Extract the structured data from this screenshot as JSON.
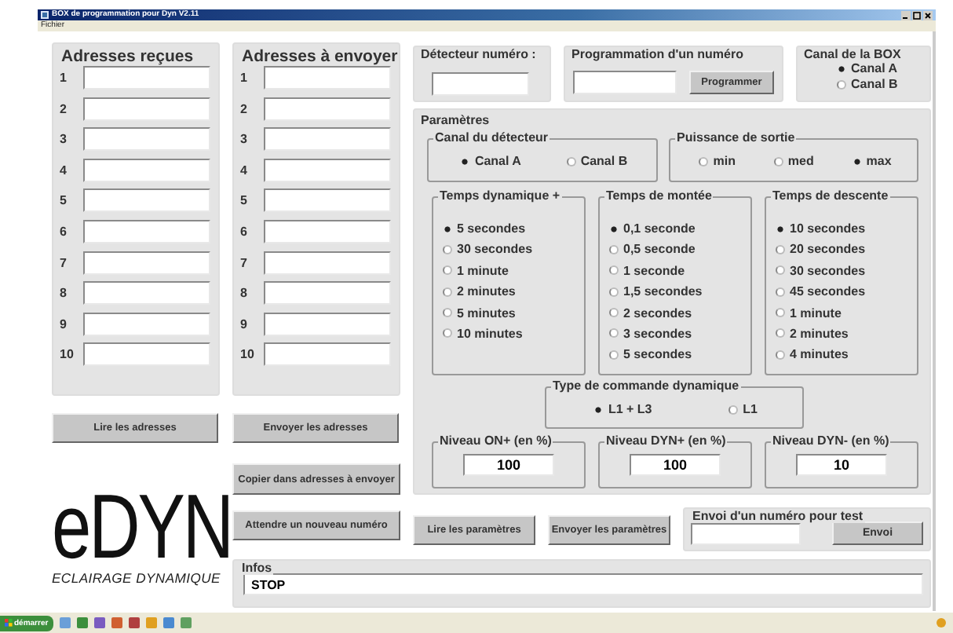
{
  "window": {
    "title": "BOX de programmation pour Dyn V2.11"
  },
  "menu": [
    "Fichier"
  ],
  "address_groups": [
    {
      "title": "Adresses reçues",
      "rows": [
        "1",
        "2",
        "3",
        "4",
        "5",
        "6",
        "7",
        "8",
        "9",
        "10"
      ]
    },
    {
      "title": "Adresses à envoyer",
      "rows": [
        "1",
        "2",
        "3",
        "4",
        "5",
        "6",
        "7",
        "8",
        "9",
        "10"
      ]
    }
  ],
  "address_buttons": [
    "Lire les adresses",
    "Envoyer les adresses"
  ],
  "copy_button": "Copier dans adresses à envoyer",
  "logo": {
    "text": "eDYN",
    "subtitle": "ECLAIRAGE DYNAMIQUE"
  },
  "detector": {
    "label": "Détecteur numéro :"
  },
  "programming": {
    "label": "Programmation d'un numéro",
    "button": "Programmer"
  },
  "box_channel": {
    "label": "Canal de la BOX",
    "options": [
      {
        "label": "Canal A",
        "selected": true
      },
      {
        "label": "Canal B",
        "selected": false
      }
    ]
  },
  "parameters": {
    "label": "Paramètres",
    "detector_channel": {
      "label": "Canal du détecteur",
      "options": [
        {
          "label": "Canal A",
          "selected": true
        },
        {
          "label": "Canal B",
          "selected": false
        }
      ]
    },
    "output_power": {
      "label": "Puissance de sortie",
      "options": [
        {
          "label": "min",
          "selected": false
        },
        {
          "label": "med",
          "selected": false
        },
        {
          "label": "max",
          "selected": true
        }
      ]
    },
    "time_groups": [
      {
        "label": "Temps dynamique +",
        "options": [
          {
            "label": "5 secondes",
            "selected": true
          },
          {
            "label": "30 secondes",
            "selected": false
          },
          {
            "label": "1 minute",
            "selected": false
          },
          {
            "label": "2 minutes",
            "selected": false
          },
          {
            "label": "5 minutes",
            "selected": false
          },
          {
            "label": "10 minutes",
            "selected": false
          }
        ]
      },
      {
        "label": "Temps de montée",
        "options": [
          {
            "label": "0,1 seconde",
            "selected": true
          },
          {
            "label": "0,5 seconde",
            "selected": false
          },
          {
            "label": "1 seconde",
            "selected": false
          },
          {
            "label": "1,5 secondes",
            "selected": false
          },
          {
            "label": "2 secondes",
            "selected": false
          },
          {
            "label": "3 secondes",
            "selected": false
          },
          {
            "label": "5 secondes",
            "selected": false
          }
        ]
      },
      {
        "label": "Temps de descente",
        "options": [
          {
            "label": "10 secondes",
            "selected": true
          },
          {
            "label": "20 secondes",
            "selected": false
          },
          {
            "label": "30 secondes",
            "selected": false
          },
          {
            "label": "45 secondes",
            "selected": false
          },
          {
            "label": "1 minute",
            "selected": false
          },
          {
            "label": "2 minutes",
            "selected": false
          },
          {
            "label": "4 minutes",
            "selected": false
          }
        ]
      }
    ],
    "command_type": {
      "label": "Type de commande dynamique",
      "options": [
        {
          "label": "L1 + L3",
          "selected": true
        },
        {
          "label": "L1",
          "selected": false
        }
      ]
    },
    "levels": [
      {
        "label": "Niveau ON+  (en %)",
        "value": "100"
      },
      {
        "label": "Niveau DYN+  (en %)",
        "value": "100"
      },
      {
        "label": "Niveau DYN-  (en %)",
        "value": "10"
      }
    ]
  },
  "action_buttons": [
    "Attendre un nouveau numéro",
    "Lire les paramètres",
    "Envoyer les paramètres"
  ],
  "test": {
    "label": "Envoi d'un numéro pour test",
    "button": "Envoi"
  },
  "infos": {
    "label": "Infos",
    "value": "STOP"
  },
  "taskbar": {
    "start": "démarrer"
  }
}
